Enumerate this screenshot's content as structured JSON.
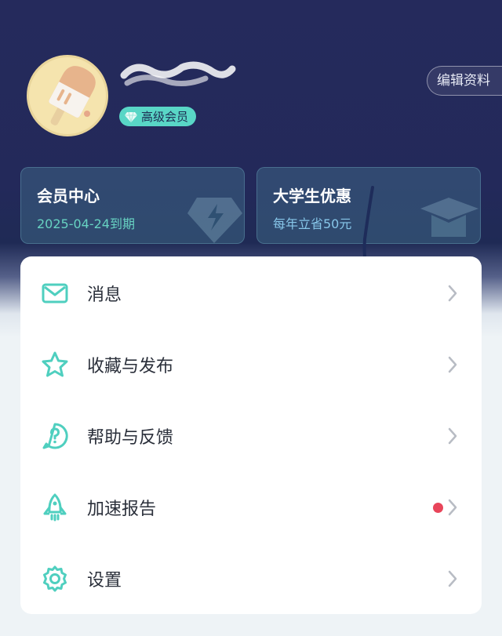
{
  "profile": {
    "username": "",
    "vip_label": "高级会员",
    "edit_label": "编辑资料"
  },
  "cards": {
    "member": {
      "title": "会员中心",
      "subtitle": "2025-04-24到期"
    },
    "student": {
      "title": "大学生优惠",
      "subtitle": "每年立省50元"
    }
  },
  "menu": {
    "items": [
      {
        "label": "消息",
        "icon": "mail-icon"
      },
      {
        "label": "收藏与发布",
        "icon": "star-icon"
      },
      {
        "label": "帮助与反馈",
        "icon": "help-icon"
      },
      {
        "label": "加速报告",
        "icon": "rocket-icon",
        "has_notification_dot": true
      },
      {
        "label": "设置",
        "icon": "gear-icon"
      }
    ]
  },
  "colors": {
    "header_dark": "#252a5c",
    "accent_teal": "#4fcfbf",
    "notification_red": "#e8455a"
  }
}
